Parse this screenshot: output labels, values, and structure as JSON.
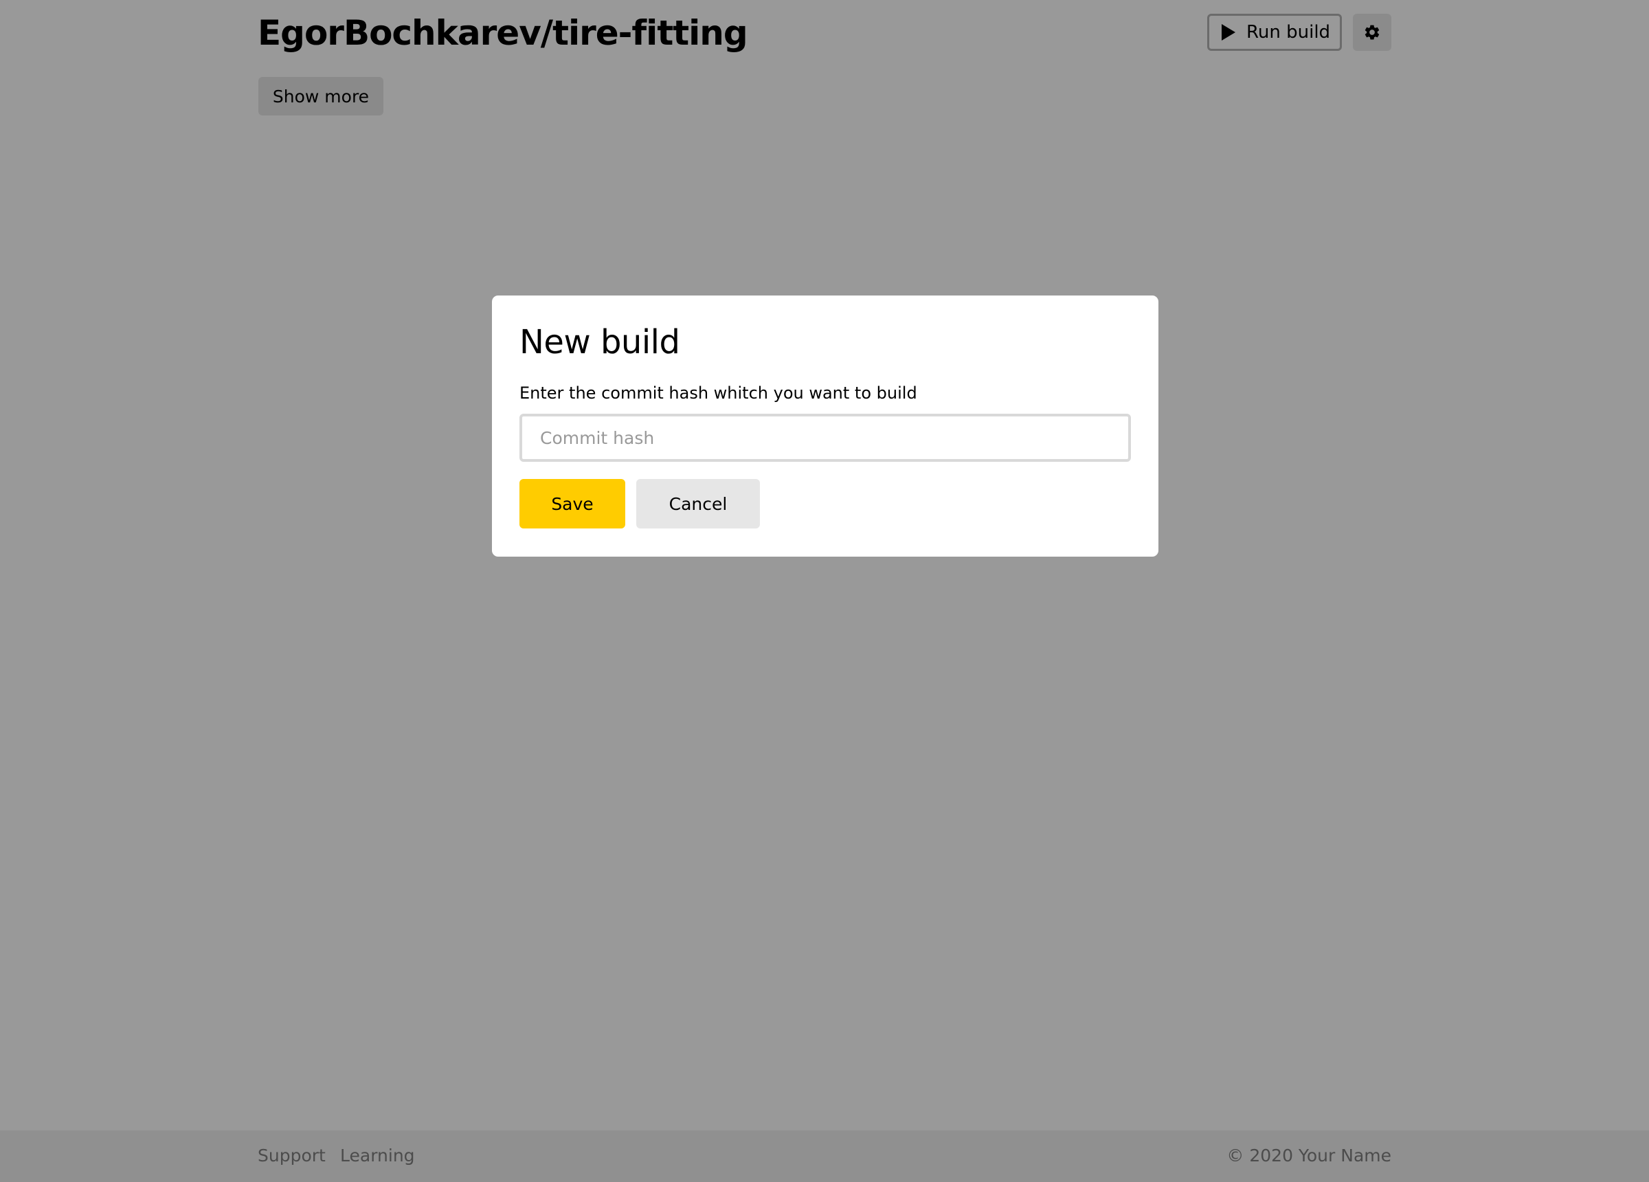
{
  "header": {
    "repo_title": "EgorBochkarev/tire-fitting",
    "run_build_label": "Run build",
    "run_build_icon": "play-icon",
    "settings_icon": "gear-icon"
  },
  "main": {
    "show_more_label": "Show more"
  },
  "modal": {
    "title": "New build",
    "description": "Enter the commit hash whitch you want to build",
    "input": {
      "placeholder": "Commit hash",
      "value": ""
    },
    "save_label": "Save",
    "cancel_label": "Cancel"
  },
  "footer": {
    "links": [
      "Support",
      "Learning"
    ],
    "copyright": "© 2020 Your Name"
  },
  "colors": {
    "accent": "#ffcc00",
    "overlay": "rgba(0,0,0,0.4)",
    "secondary_button": "#e6e6e6",
    "footer_bg": "#f0f0f0"
  }
}
